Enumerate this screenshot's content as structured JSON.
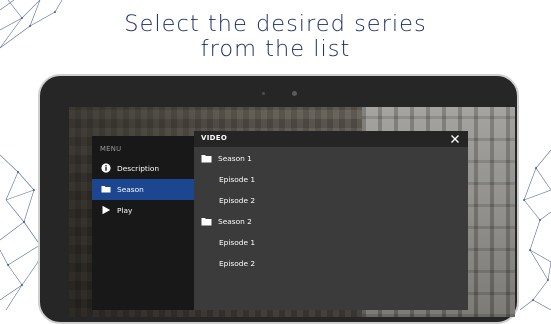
{
  "headline": {
    "line1": "Select the desired series",
    "line2": "from the list"
  },
  "colors": {
    "headline": "#1e2f66",
    "accent": "#1d4690",
    "menu_bg": "#181818",
    "panel_bg": "#3b3b3b"
  },
  "menu": {
    "title": "MENU",
    "items": [
      {
        "label": "Description",
        "icon": "info-icon",
        "active": false
      },
      {
        "label": "Season",
        "icon": "folder-icon",
        "active": true
      },
      {
        "label": "Play",
        "icon": "play-icon",
        "active": false
      }
    ]
  },
  "panel": {
    "title": "VIDEO",
    "close_icon": "close-icon",
    "rows": [
      {
        "label": "Season 1",
        "type": "folder",
        "icon": "folder-icon"
      },
      {
        "label": "Episode 1",
        "type": "episode"
      },
      {
        "label": "Episode 2",
        "type": "episode"
      },
      {
        "label": "Season 2",
        "type": "folder",
        "icon": "folder-icon"
      },
      {
        "label": "Episode 1",
        "type": "episode"
      },
      {
        "label": "Episode 2",
        "type": "episode"
      }
    ]
  }
}
